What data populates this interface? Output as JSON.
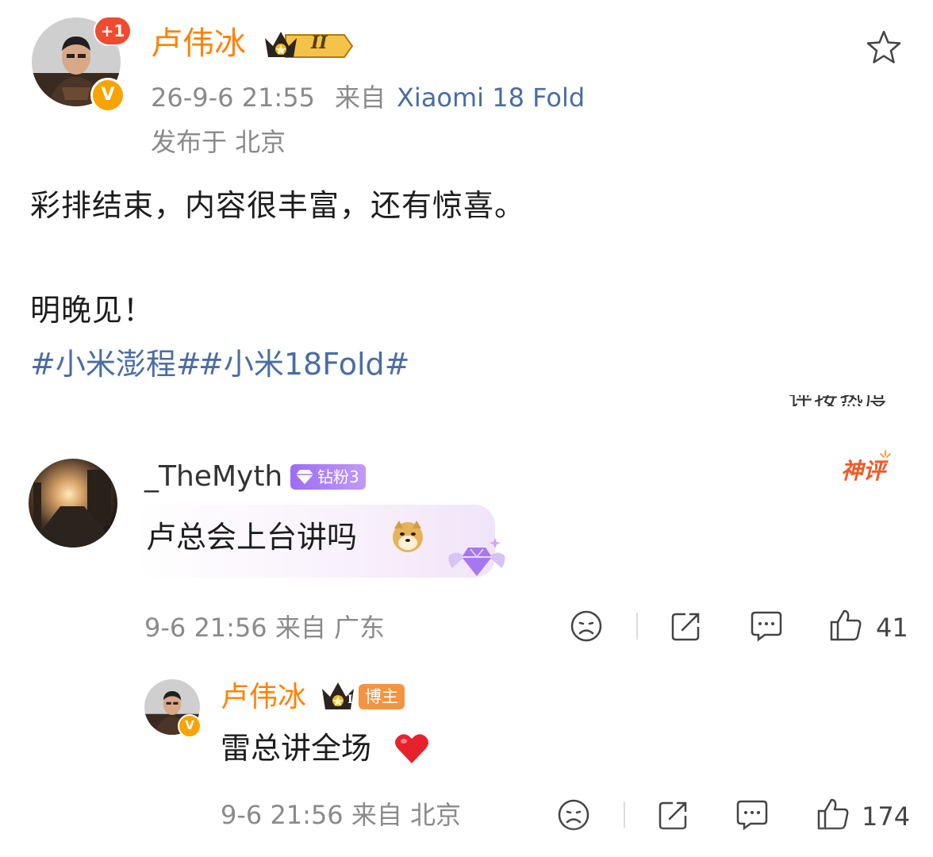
{
  "post": {
    "author_name": "卢伟冰",
    "plus_badge": "+1",
    "vip_level": "II",
    "verify_mark": "V",
    "time": "26-9-6 21:55",
    "source_prefix": "来自",
    "device": "Xiaomi 18 Fold",
    "location": "发布于 北京",
    "line1": "彩排结束，内容很丰富，还有惊喜。",
    "line2": "明晚见！",
    "hashtag1": "#小米澎程#",
    "hashtag2": "#小米18Fold#",
    "cut_text": "评按热度",
    "icons": {
      "star": "star-icon"
    }
  },
  "comment": {
    "username": "_TheMyth",
    "fan_badge": "钻粉3",
    "hot_tag": "神评",
    "text": "卢总会上台讲吗",
    "emoji": "doge-emoji",
    "time_location": "9-6 21:56 来自 广东",
    "likes": "41",
    "icons": [
      "sad-face-icon",
      "share-icon",
      "comment-icon",
      "thumbs-up-icon"
    ]
  },
  "reply": {
    "username": "卢伟冰",
    "vip_level": "II",
    "blogger_badge": "博主",
    "verify_mark": "V",
    "text": "雷总讲全场",
    "emoji": "red-heart-icon",
    "time_location": "9-6 21:56 来自 北京",
    "likes": "174"
  },
  "colors": {
    "name_orange": "#ff8200",
    "link_blue": "#4a6da3",
    "meta_gray": "#8a8a8a",
    "verify_orange": "#f7a400",
    "fan_purple": "#9d6cf6",
    "hot_red": "#f05a24"
  }
}
